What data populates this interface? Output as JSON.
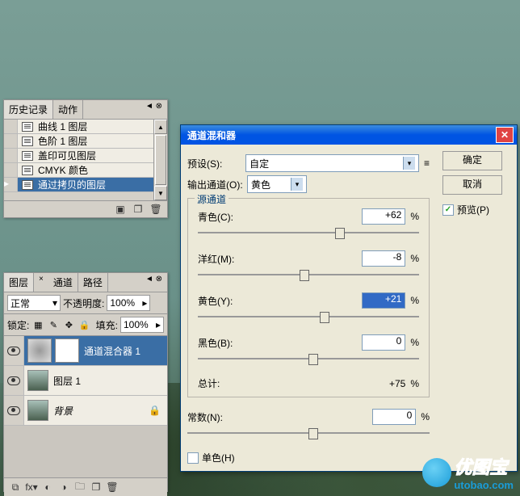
{
  "history": {
    "tabs": [
      "历史记录",
      "动作"
    ],
    "items": [
      {
        "label": "曲线 1 图层"
      },
      {
        "label": "色阶 1 图层"
      },
      {
        "label": "盖印可见图层"
      },
      {
        "label": "CMYK 颜色"
      },
      {
        "label": "通过拷贝的图层",
        "selected": true
      }
    ]
  },
  "layers": {
    "tabs": [
      "图层",
      "通道",
      "路径"
    ],
    "blend_label": "正常",
    "opacity_label": "不透明度:",
    "opacity_value": "100%",
    "lock_label": "锁定:",
    "fill_label": "填充:",
    "fill_value": "100%",
    "rows": [
      {
        "label": "通道混合器 1",
        "selected": true,
        "mask": true
      },
      {
        "label": "图层 1"
      },
      {
        "label": "背景",
        "locked": true
      }
    ]
  },
  "dialog": {
    "title": "通道混和器",
    "preset_label": "预设(S):",
    "preset_value": "自定",
    "channel_label": "输出通道(O):",
    "channel_value": "黄色",
    "ok": "确定",
    "cancel": "取消",
    "preview": "预览(P)",
    "source_legend": "源通道",
    "sliders": {
      "cyan": {
        "label": "青色(C):",
        "value": "+62",
        "pos": 62
      },
      "magenta": {
        "label": "洋红(M):",
        "value": "-8",
        "pos": 46
      },
      "yellow": {
        "label": "黄色(Y):",
        "value": "+21",
        "pos": 55,
        "hl": true
      },
      "black": {
        "label": "黑色(B):",
        "value": "0",
        "pos": 50
      }
    },
    "total_label": "总计:",
    "total_value": "+75",
    "pct": "%",
    "constant": {
      "label": "常数(N):",
      "value": "0",
      "pos": 50
    },
    "mono_label": "单色(H)"
  },
  "watermark": {
    "brand": "优图宝",
    "url": "utobao.com"
  }
}
